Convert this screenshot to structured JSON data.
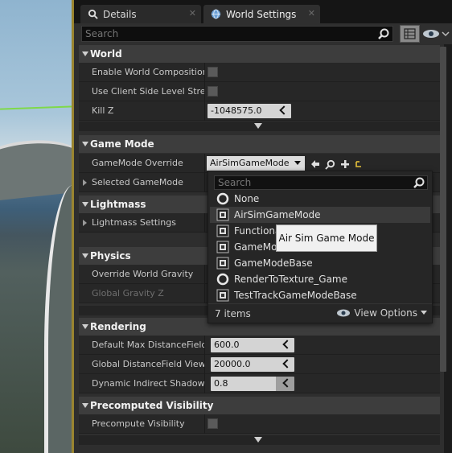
{
  "tabs": [
    {
      "label": "Details",
      "icon": "magnifier-icon"
    },
    {
      "label": "World Settings",
      "icon": "globe-icon"
    }
  ],
  "search": {
    "placeholder": "Search"
  },
  "categories": {
    "world": "World",
    "game_mode": "Game Mode",
    "lightmass": "Lightmass",
    "physics": "Physics",
    "rendering": "Rendering",
    "precomputed_visibility": "Precomputed Visibility"
  },
  "world": {
    "enable_world_composition": "Enable World Composition",
    "use_client_side_level_streaming": "Use Client Side Level Stream",
    "kill_z_label": "Kill Z",
    "kill_z_value": "-1048575.0"
  },
  "game_mode": {
    "override_label": "GameMode Override",
    "override_value": "AirSimGameMode",
    "selected_label": "Selected GameMode"
  },
  "lightmass": {
    "settings_label": "Lightmass Settings"
  },
  "physics": {
    "override_gravity": "Override World Gravity",
    "global_gravity": "Global Gravity Z"
  },
  "rendering": {
    "max_df_label": "Default Max DistanceField C",
    "max_df_value": "600.0",
    "global_df_label": "Global DistanceField View D",
    "global_df_value": "20000.0",
    "dyn_shadows_label": "Dynamic Indirect Shadows S",
    "dyn_shadows_value": "0.8"
  },
  "precomputed": {
    "precompute_label": "Precompute Visibility"
  },
  "dropdown": {
    "search_placeholder": "Search",
    "options": [
      {
        "label": "None",
        "icon": "circle-icon"
      },
      {
        "label": "AirSimGameMode",
        "icon": "blueprint-icon"
      },
      {
        "label": "Functiona",
        "icon": "blueprint-icon"
      },
      {
        "label": "GameMo",
        "icon": "blueprint-icon"
      },
      {
        "label": "GameModeBase",
        "icon": "blueprint-icon"
      },
      {
        "label": "RenderToTexture_Game",
        "icon": "circle-icon"
      },
      {
        "label": "TestTrackGameModeBase",
        "icon": "blueprint-icon"
      }
    ],
    "count": "7 items",
    "view_options": "View Options"
  },
  "tooltip": "Air Sim Game Mode"
}
